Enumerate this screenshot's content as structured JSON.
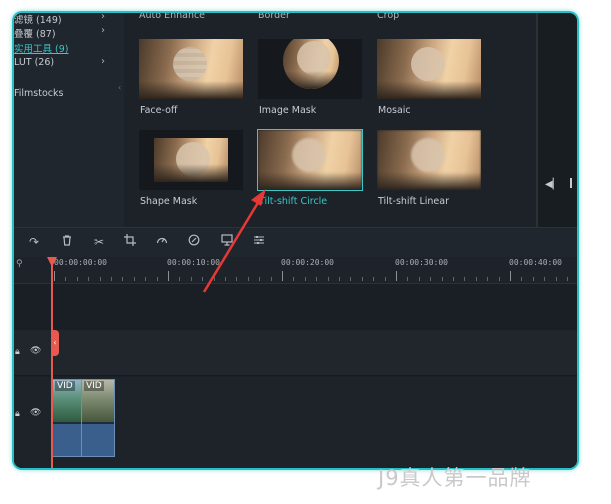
{
  "sidebar": {
    "items": [
      {
        "label": "滤镜 (149)",
        "active": false,
        "chevron": true
      },
      {
        "label": "叠覆 (87)",
        "active": false,
        "chevron": true
      },
      {
        "label": "实用工具 (9)",
        "active": true,
        "chevron": false
      },
      {
        "label": "LUT (26)",
        "active": false,
        "chevron": true
      },
      {
        "label": "Filmstocks",
        "active": false,
        "chevron": false
      }
    ]
  },
  "effects": {
    "top_row_labels": [
      "Auto Enhance",
      "Border",
      "Crop"
    ],
    "tiles": [
      {
        "label": "Face-off",
        "selected": false
      },
      {
        "label": "Image Mask",
        "selected": false
      },
      {
        "label": "Mosaic",
        "selected": false
      },
      {
        "label": "Shape Mask",
        "selected": false
      },
      {
        "label": "Tilt-shift Circle",
        "selected": true
      },
      {
        "label": "Tilt-shift Linear",
        "selected": false
      }
    ]
  },
  "toolbar": {
    "tools": [
      "redo-icon",
      "delete-icon",
      "cut-icon",
      "crop-icon",
      "speed-icon",
      "color-icon",
      "snapshot-icon",
      "adjust-icon"
    ]
  },
  "timeline": {
    "ruler_labels": [
      "00:00:00:00",
      "00:00:10:00",
      "00:00:20:00",
      "00:00:30:00",
      "00:00:40:00"
    ],
    "clips": [
      {
        "label": "VID"
      },
      {
        "label": "VID"
      }
    ]
  },
  "colors": {
    "accent": "#3bc6c8",
    "playhead": "#e85a4f",
    "annotation_arrow": "#e53935"
  },
  "watermark": "J9真人第一品牌"
}
